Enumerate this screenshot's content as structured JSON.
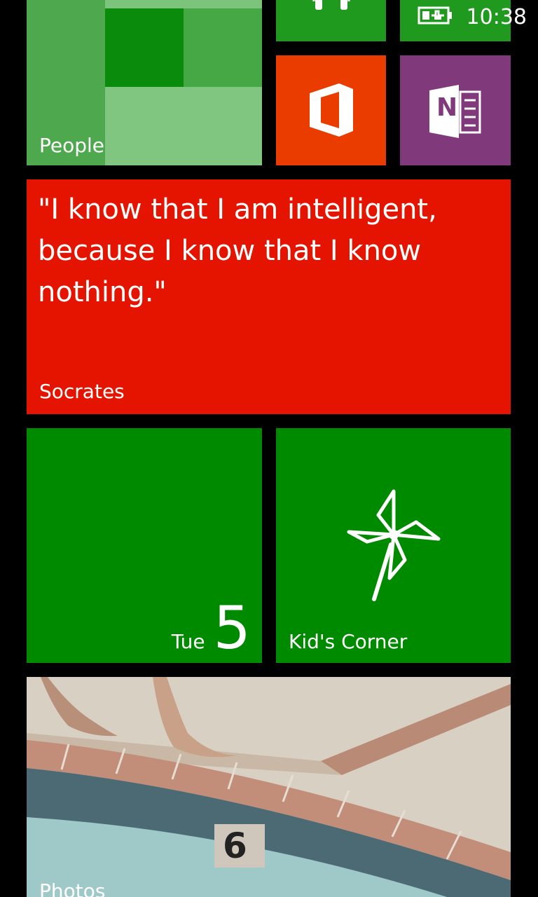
{
  "status_bar": {
    "time": "10:38",
    "battery_icon": "battery-charging-icon"
  },
  "tiles": {
    "people": {
      "label": "People"
    },
    "music": {
      "icon": "headphones-icon"
    },
    "office": {
      "icon": "office-icon"
    },
    "onenote": {
      "icon": "onenote-icon",
      "letter": "N"
    },
    "quote": {
      "text": "\"I know that I am intelligent, because I know that I know nothing.\"",
      "author": "Socrates"
    },
    "calendar": {
      "day": "Tue",
      "date": "5"
    },
    "kids_corner": {
      "label": "Kid's Corner",
      "icon": "pinwheel-icon"
    },
    "photos": {
      "label": "Photos",
      "pool_number": "6"
    }
  },
  "colors": {
    "green": "#008a00",
    "red": "#e51400",
    "orange": "#eb3c00",
    "purple": "#80397b",
    "background": "#000000"
  }
}
